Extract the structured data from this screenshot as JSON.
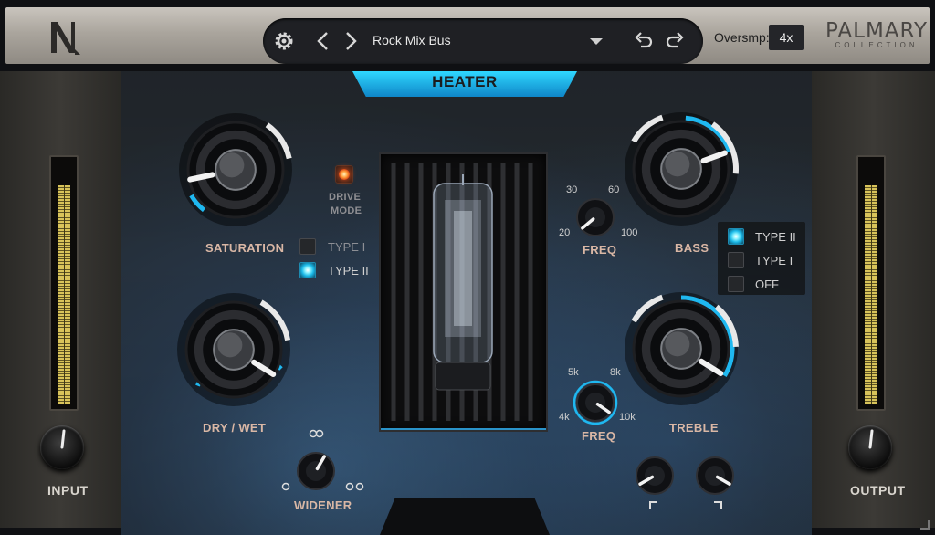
{
  "header": {
    "preset_name": "Rock Mix Bus",
    "oversampling_label": "Oversmp:",
    "oversampling_value": "4x",
    "brand_line1": "PALMARY",
    "brand_line2": "COLLECTION"
  },
  "plugin": {
    "title": "HEATER"
  },
  "io": {
    "input_label": "INPUT",
    "output_label": "OUTPUT",
    "input_meter_level": 0.88,
    "output_meter_level": 0.88
  },
  "saturation": {
    "label": "SATURATION",
    "drive_mode_label_1": "DRIVE",
    "drive_mode_label_2": "MODE",
    "type_options": [
      {
        "label": "TYPE I",
        "selected": false
      },
      {
        "label": "TYPE II",
        "selected": true
      }
    ]
  },
  "dry_wet": {
    "label": "DRY / WET"
  },
  "widener": {
    "label": "WIDENER"
  },
  "bass": {
    "label": "BASS",
    "freq_label": "FREQ",
    "freq_ticks": [
      "30",
      "60",
      "20",
      "100"
    ],
    "type_options": [
      {
        "label": "TYPE II",
        "selected": true
      },
      {
        "label": "TYPE I",
        "selected": false
      },
      {
        "label": "OFF",
        "selected": false
      }
    ]
  },
  "treble": {
    "label": "TREBLE",
    "freq_label": "FREQ",
    "freq_ticks": [
      "5k",
      "8k",
      "4k",
      "10k"
    ]
  },
  "colors": {
    "accent": "#1fb8f0",
    "label": "#d9b7a5",
    "meter": "#d8c35a"
  }
}
